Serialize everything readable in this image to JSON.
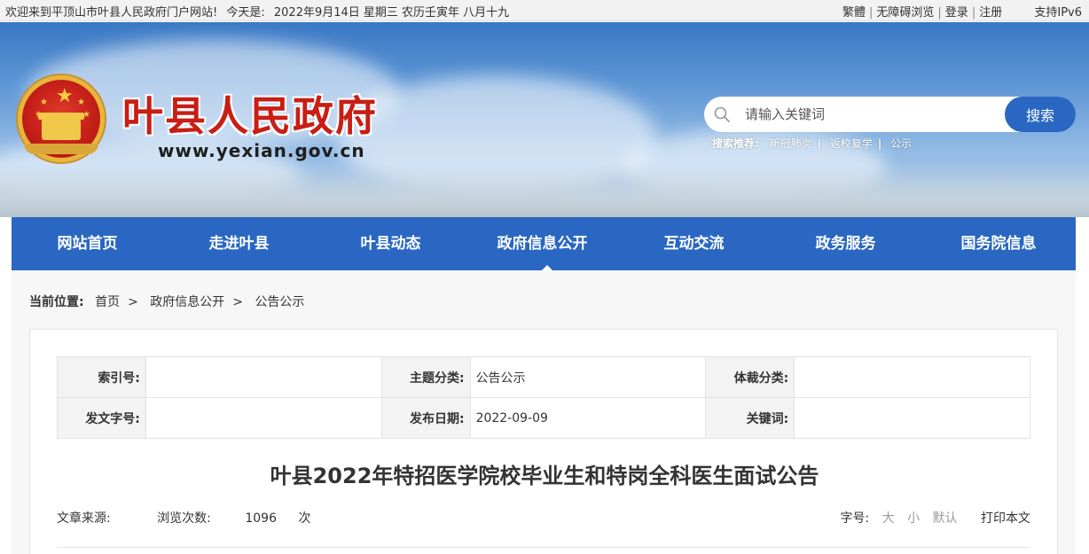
{
  "topbar": {
    "welcome": "欢迎来到平顶山市叶县人民政府门户网站!",
    "today_label": "今天是:",
    "date": "2022年9月14日 星期三 农历壬寅年 八月十九",
    "links": {
      "traditional": "繁體",
      "accessibility": "无障碍浏览",
      "login": "登录",
      "register": "注册",
      "ipv6": "支持IPv6"
    }
  },
  "header": {
    "site_title": "叶县人民政府",
    "site_url": "www.yexian.gov.cn",
    "search": {
      "placeholder": "请输入关键词",
      "button": "搜索",
      "hot_label": "搜索推荐:",
      "hot": [
        "新冠肺炎",
        "返校复学",
        "公示"
      ]
    }
  },
  "nav": {
    "items": [
      "网站首页",
      "走进叶县",
      "叶县动态",
      "政府信息公开",
      "互动交流",
      "政务服务",
      "国务院信息"
    ],
    "active_index": 3
  },
  "breadcrumb": {
    "label": "当前位置:",
    "items": [
      "首页",
      "政府信息公开",
      "公告公示"
    ]
  },
  "meta": {
    "index_no_label": "索引号:",
    "index_no": "",
    "topic_label": "主题分类:",
    "topic": "公告公示",
    "genre_label": "体裁分类:",
    "genre": "",
    "doc_no_label": "发文字号:",
    "doc_no": "",
    "publish_date_label": "发布日期:",
    "publish_date": "2022-09-09",
    "keywords_label": "关键词:",
    "keywords": ""
  },
  "article": {
    "title": "叶县2022年特招医学院校毕业生和特岗全科医生面试公告",
    "source_label": "文章来源:",
    "source": "",
    "views_label": "浏览次数:",
    "views": "1096",
    "views_unit": "次",
    "fontsize_label": "字号:",
    "font_large": "大",
    "font_small": "小",
    "font_default": "默认",
    "print": "打印本文"
  },
  "colors": {
    "primary": "#2a67c2",
    "title_red": "#c81e14",
    "gold": "#e9b53a"
  },
  "icons": {
    "search": "search-icon",
    "emblem": "national-emblem-icon"
  }
}
